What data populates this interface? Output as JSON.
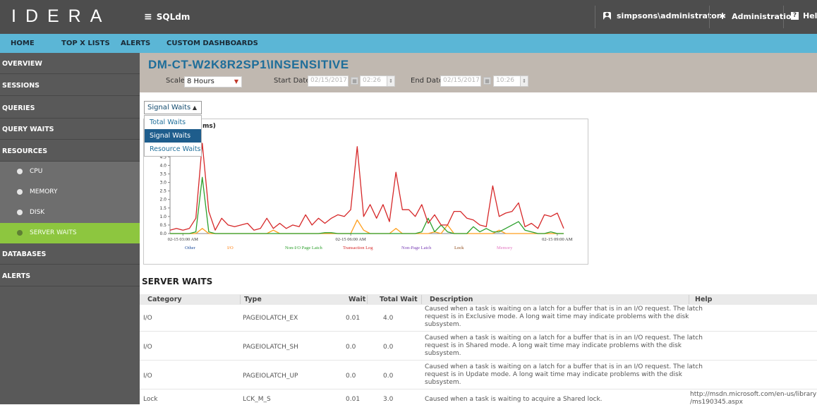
{
  "topbar": {
    "logo": "IDERA",
    "product": "SQLdm",
    "user": "simpsons\\administrator",
    "admin": "Administration",
    "help": "Hel"
  },
  "nav": [
    "HOME",
    "TOP X LISTS",
    "ALERTS",
    "CUSTOM DASHBOARDS"
  ],
  "sidebar": {
    "items": [
      "OVERVIEW",
      "SESSIONS",
      "QUERIES",
      "QUERY WAITS",
      "RESOURCES"
    ],
    "sub_items": [
      "CPU",
      "MEMORY",
      "DISK",
      "SERVER WAITS"
    ],
    "active_sub": "SERVER WAITS",
    "bottom_items": [
      "DATABASES",
      "ALERTS"
    ]
  },
  "header": {
    "server": "DM-CT-W2K8R2SP1\\INSENSITIVE",
    "scale_label": "Scale:",
    "scale_value": "8 Hours",
    "start_label": "Start Date:",
    "start_date": "02/15/2017",
    "start_time": "02:26",
    "end_label": "End Date:",
    "end_date": "02/15/2017",
    "end_time": "10:26"
  },
  "wait_select": {
    "value": "Signal Waits",
    "options": [
      "Total Waits",
      "Signal Waits",
      "Resource Waits"
    ],
    "selected": "Signal Waits"
  },
  "chart_data": {
    "type": "line",
    "title": "ms)",
    "y_ticks": [
      "0.0",
      "0.5",
      "1.0",
      "1.5",
      "2.0",
      "2.5",
      "3.0",
      "3.5",
      "4.0",
      "4.5"
    ],
    "ylim": [
      0,
      5.3
    ],
    "x_ticks": [
      "02-15 03:00 AM",
      "02-15 06:00 AM",
      "02-15 09:00 AM"
    ],
    "x_tick_index": [
      2,
      28,
      60
    ],
    "legend": [
      "Other",
      "I/O",
      "Non-I/O Page Latch",
      "Transaction Log",
      "Non-Page Latch",
      "Lock",
      "Memory"
    ],
    "series": [
      {
        "name": "Transaction Log",
        "color": "#d62728",
        "values": [
          0.2,
          0.3,
          0.2,
          0.3,
          0.9,
          5.3,
          1.3,
          0.2,
          0.9,
          0.5,
          0.4,
          0.5,
          0.6,
          0.2,
          0.3,
          0.9,
          0.3,
          0.6,
          0.3,
          0.5,
          0.4,
          1.1,
          0.5,
          0.9,
          0.6,
          0.9,
          1.1,
          1.0,
          1.4,
          5.1,
          1.0,
          1.7,
          0.9,
          1.7,
          0.7,
          3.6,
          1.4,
          1.4,
          1.0,
          1.7,
          0.6,
          1.1,
          0.5,
          0.5,
          1.3,
          1.3,
          0.9,
          0.8,
          0.5,
          0.4,
          2.8,
          1.0,
          1.2,
          1.3,
          1.8,
          0.4,
          0.6,
          0.3,
          1.1,
          1.0,
          1.2,
          0.3
        ]
      },
      {
        "name": "Non-I/O Page Latch",
        "color": "#2ca02c",
        "values": [
          0,
          0,
          0,
          0,
          0.1,
          3.3,
          0.1,
          0,
          0,
          0,
          0,
          0,
          0,
          0,
          0,
          0,
          0,
          0,
          0,
          0,
          0,
          0,
          0,
          0,
          0.05,
          0.05,
          0,
          0,
          0,
          0,
          0,
          0,
          0,
          0,
          0,
          0,
          0,
          0,
          0,
          0.1,
          0.9,
          0.1,
          0.5,
          0.1,
          0,
          0,
          0,
          0.4,
          0.1,
          0.3,
          0.1,
          0.1,
          0.3,
          0.5,
          0.7,
          0.2,
          0.1,
          0,
          0,
          0.1,
          0,
          0
        ]
      },
      {
        "name": "I/O",
        "color": "#ff9f1c",
        "values": [
          0,
          0,
          0,
          0,
          0,
          0.3,
          0,
          0,
          0,
          0,
          0,
          0,
          0,
          0,
          0,
          0,
          0.2,
          0,
          0,
          0,
          0,
          0,
          0,
          0,
          0,
          0,
          0,
          0,
          0,
          0.8,
          0.2,
          0,
          0,
          0,
          0,
          0.3,
          0,
          0,
          0,
          0,
          0,
          0.1,
          0,
          0.5,
          0,
          0,
          0,
          0,
          0,
          0,
          0,
          0.2,
          0,
          0,
          0,
          0,
          0,
          0,
          0,
          0,
          0,
          0
        ]
      }
    ]
  },
  "server_waits": {
    "title": "SERVER WAITS",
    "columns": [
      "Category",
      "Type",
      "Wait",
      "Total Wait",
      "Description",
      "Help"
    ],
    "rows": [
      {
        "category": "I/O",
        "type": "PAGEIOLATCH_EX",
        "wait": "0.01",
        "total": "4.0",
        "desc": [
          "Caused when a task is waiting on a latch for a buffer that is in an I/O request. The latch",
          "request is in Exclusive mode. A long wait time may indicate problems with the disk",
          "subsystem."
        ],
        "help": [
          "",
          ""
        ]
      },
      {
        "category": "I/O",
        "type": "PAGEIOLATCH_SH",
        "wait": "0.0",
        "total": "0.0",
        "desc": [
          "Caused when a task is waiting on a latch for a buffer that is in an I/O request. The latch",
          "request is in Shared mode. A long wait time may indicate problems with the disk",
          "subsystem."
        ],
        "help": [
          "",
          ""
        ]
      },
      {
        "category": "I/O",
        "type": "PAGEIOLATCH_UP",
        "wait": "0.0",
        "total": "0.0",
        "desc": [
          "Caused when a task is waiting on a latch for a buffer that is in an I/O request. The latch",
          "request is in Update mode. A long wait time may indicate problems with the disk",
          "subsystem."
        ],
        "help": [
          "",
          ""
        ]
      },
      {
        "category": "Lock",
        "type": "LCK_M_S",
        "wait": "0.01",
        "total": "3.0",
        "desc": [
          "Caused when a task is waiting to acquire a Shared lock.",
          "",
          ""
        ],
        "help": [
          "http://msdn.microsoft.com/en-us/library",
          "/ms190345.aspx"
        ]
      }
    ]
  }
}
